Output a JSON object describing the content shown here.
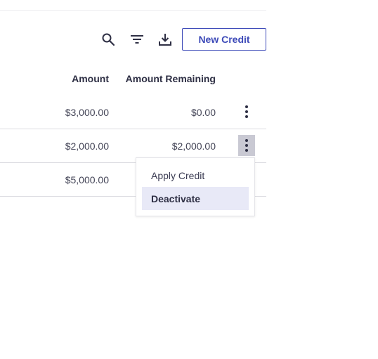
{
  "toolbar": {
    "icons": [
      "search-icon",
      "filter-icon",
      "download-icon"
    ],
    "new_credit_label": "New Credit",
    "accent_color": "#3d4ab8"
  },
  "table": {
    "columns": {
      "amount": "Amount",
      "remaining": "Amount Remaining"
    },
    "rows": [
      {
        "amount": "$3,000.00",
        "remaining": "$0.00"
      },
      {
        "amount": "$2,000.00",
        "remaining": "$2,000.00"
      },
      {
        "amount": "$5,000.00",
        "remaining": ""
      }
    ]
  },
  "menu": {
    "items": [
      {
        "label": "Apply Credit"
      },
      {
        "label": "Deactivate",
        "highlighted": true
      }
    ]
  }
}
